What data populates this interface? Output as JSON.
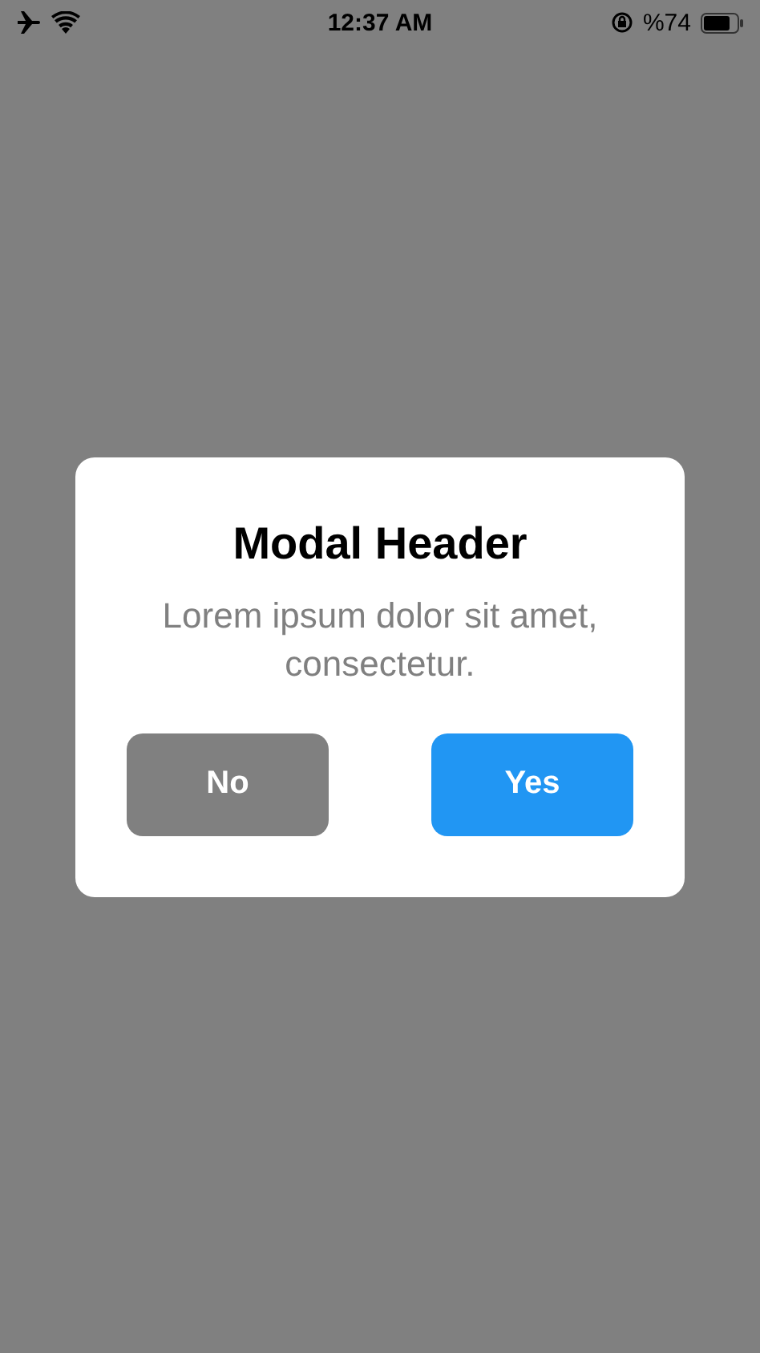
{
  "status_bar": {
    "time": "12:37 AM",
    "battery_text": "%74"
  },
  "modal": {
    "title": "Modal Header",
    "message": "Lorem ipsum dolor sit amet, consectetur.",
    "buttons": [
      {
        "label": "No",
        "kind": "cancel"
      },
      {
        "label": "Yes",
        "kind": "confirm"
      }
    ]
  }
}
